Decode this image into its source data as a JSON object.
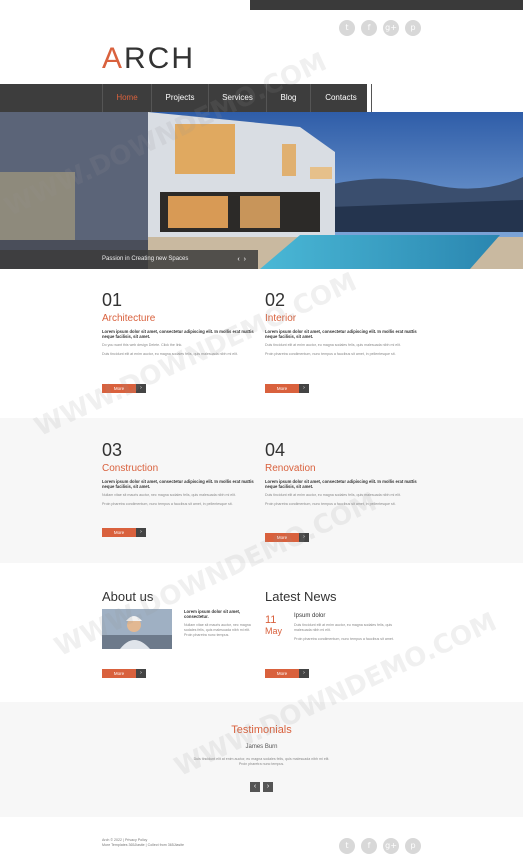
{
  "brand": {
    "logo_first": "A",
    "logo_rest": "RCH",
    "accent": "#d9613d"
  },
  "social": [
    {
      "name": "twitter-icon",
      "glyph": "t"
    },
    {
      "name": "facebook-icon",
      "glyph": "f"
    },
    {
      "name": "google-plus-icon",
      "glyph": "g+"
    },
    {
      "name": "pinterest-icon",
      "glyph": "p"
    }
  ],
  "nav": [
    {
      "label": "Home",
      "active": true
    },
    {
      "label": "Projects",
      "active": false
    },
    {
      "label": "Services",
      "active": false
    },
    {
      "label": "Blog",
      "active": false
    },
    {
      "label": "Contacts",
      "active": false
    }
  ],
  "hero": {
    "caption": "Passion in Creating new Spaces",
    "prev": "‹",
    "next": "›"
  },
  "services": [
    {
      "num": "01",
      "title": "Architecture",
      "lead": "Lorem ipsum dolor sit amet, consectetur adipiscing elit. In mollis erat mattis neque facilisis, sit amet.",
      "text1": "Do you want this web design Delete. Click the link.",
      "text2": "Duis tincidunt elit at enim auctor, eu magna sodales felis, quis malesuada nibh mi elit.",
      "more": "More"
    },
    {
      "num": "02",
      "title": "Interior",
      "lead": "Lorem ipsum dolor sit amet, consectetur adipiscing elit. In mollis erat mattis neque facilisis, sit amet.",
      "text1": "Duis tincidunt elit at enim auctor, eu magna sodales felis, quis malesuada nibh mi elit.",
      "text2": "Proin pharetra condimentum, nunc tempus a faucibus sit amet, in pellentesque sit.",
      "more": "More"
    },
    {
      "num": "03",
      "title": "Construction",
      "lead": "Lorem ipsum dolor sit amet, consectetur adipiscing elit. In mollis erat mattis neque facilisis, sit amet.",
      "text1": "Nullam vitae sit mauris auctor, nec magna sodales felis, quis malesuada nibh mi elit.",
      "text2": "Proin pharetra condimentum, nunc tempus a faucibus sit amet, in pellentesque sit.",
      "more": "More"
    },
    {
      "num": "04",
      "title": "Renovation",
      "lead": "Lorem ipsum dolor sit amet, consectetur adipiscing elit. In mollis erat mattis neque facilisis, sit amet.",
      "text1": "Duis tincidunt elit at enim auctor, eu magna sodales felis, quis malesuada nibh mi elit.",
      "text2": "Proin pharetra condimentum, nunc tempus a faucibus sit amet, in pellentesque sit.",
      "more": "More"
    }
  ],
  "about": {
    "heading": "About us",
    "lead": "Lorem ipsum dolor sit amet, consectetur.",
    "text": "Nullam vitae sit mauris auctor, nec magna sodales felis, quis malesuada nibh mi elit. Proin pharetra nunc tempus.",
    "more": "More"
  },
  "news": {
    "heading": "Latest News",
    "day": "11",
    "month": "May",
    "title": "Ipsum dolor",
    "text1": "Duis tincidunt elit at enim auctor, eu magna sodales felis, quis malesuada nibh mi elit.",
    "text2": "Proin pharetra condimentum, nunc tempus a faucibus sit amet.",
    "more": "More"
  },
  "testimonials": {
    "heading": "Testimonials",
    "name": "James Burn",
    "text": "Duis tincidunt elit at enim auctor, eu magna sodales felis, quis malesuada nibh mi elit. Proin pharetra nunc tempus.",
    "prev": "‹",
    "next": "›"
  },
  "footer": {
    "line1": "Arch © 2022 | Privacy Policy",
    "line2": "More Templates 365Jiasite | Collect from 365Jiasite"
  },
  "watermark": "WWW.DOWNDEMO.COM"
}
